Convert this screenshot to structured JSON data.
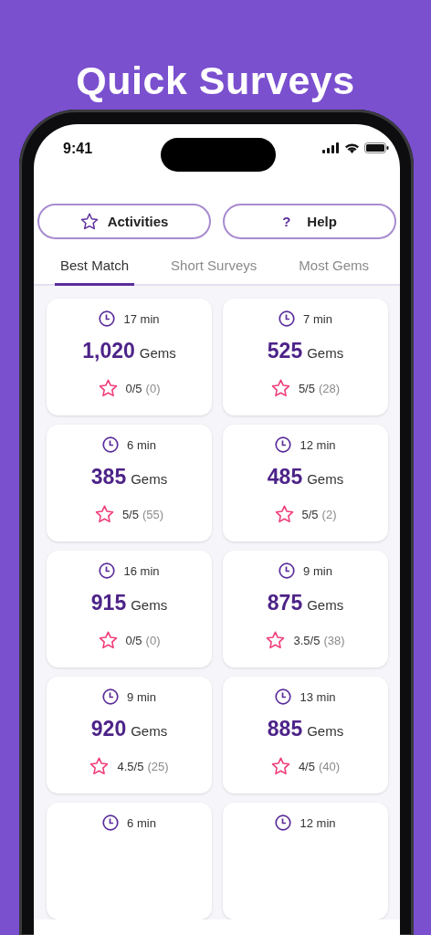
{
  "headline": "Quick Surveys",
  "status_bar": {
    "time": "9:41"
  },
  "buttons": [
    {
      "label": "Activities",
      "kind": "star"
    },
    {
      "label": "Help",
      "kind": "help",
      "icon": "?"
    }
  ],
  "tabs": [
    {
      "label": "Best Match",
      "selected": true
    },
    {
      "label": "Short Surveys",
      "selected": false
    },
    {
      "label": "Most Gems",
      "selected": false
    }
  ],
  "surveys": [
    {
      "duration": "17 min",
      "gems": "1,020",
      "unit": "Gems",
      "rating": "0/5",
      "count": "(0)"
    },
    {
      "duration": "7 min",
      "gems": "525",
      "unit": "Gems",
      "rating": "5/5",
      "count": "(28)"
    },
    {
      "duration": "6 min",
      "gems": "385",
      "unit": "Gems",
      "rating": "5/5",
      "count": "(55)"
    },
    {
      "duration": "12 min",
      "gems": "485",
      "unit": "Gems",
      "rating": "5/5",
      "count": "(2)"
    },
    {
      "duration": "16 min",
      "gems": "915",
      "unit": "Gems",
      "rating": "0/5",
      "count": "(0)"
    },
    {
      "duration": "9 min",
      "gems": "875",
      "unit": "Gems",
      "rating": "3.5/5",
      "count": "(38)"
    },
    {
      "duration": "9 min",
      "gems": "920",
      "unit": "Gems",
      "rating": "4.5/5",
      "count": "(25)"
    },
    {
      "duration": "13 min",
      "gems": "885",
      "unit": "Gems",
      "rating": "4/5",
      "count": "(40)"
    },
    {
      "duration": "6 min"
    },
    {
      "duration": "12 min"
    }
  ]
}
